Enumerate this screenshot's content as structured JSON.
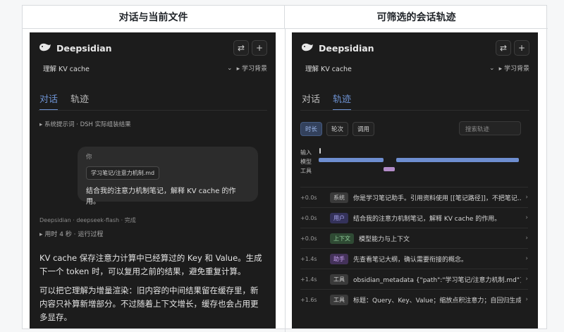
{
  "headers": {
    "left": "对话与当前文件",
    "right": "可筛选的会话轨迹"
  },
  "app": {
    "name": "Deepsidian",
    "conversation_title": "理解 KV cache",
    "context_label": "学习背景",
    "btn_sliders_icon": "sliders-icon",
    "btn_new_icon": "plus-icon"
  },
  "tabs": {
    "chat": "对话",
    "trace": "轨迹"
  },
  "left": {
    "system_line": "▸ 系统提示词 · DSH 实际组装结果",
    "user_bubble": {
      "who": "你",
      "attachment": "学习笔记/注意力机制.md",
      "message": "结合我的注意力机制笔记，解释 KV cache 的作用。"
    },
    "assistant_meta": "Deepsidian · deepseek-flash · 完成",
    "thinking": "▸ 用时 4 秒 · 运行过程",
    "answer_p1": "KV cache 保存注意力计算中已经算过的 Key 和 Value。生成下一个 token 时，可以复用之前的结果，避免重复计算。",
    "answer_p2": "可以把它理解为增量渲染：旧内容的中间结果留在缓存里，新内容只补算新增部分。不过随着上下文增长，缓存也会占用更多显存。"
  },
  "right": {
    "filters": [
      "时长",
      "轮次",
      "调用"
    ],
    "active_filter": "时长",
    "search_placeholder": "搜索轨迹",
    "lanes": [
      "输入",
      "模型",
      "工具"
    ],
    "rows": [
      {
        "time": "+0.0s",
        "kind": "系统",
        "text": "你是学习笔记助手。引用资料使用 [[笔记路径]]，不把笔记..."
      },
      {
        "time": "+0.0s",
        "kind": "用户",
        "text": "结合我的注意力机制笔记，解释 KV cache 的作用。"
      },
      {
        "time": "+0.0s",
        "kind": "上下文",
        "text": "模型能力与上下文"
      },
      {
        "time": "+1.4s",
        "kind": "助手",
        "text": "先查看笔记大纲，确认需要衔接的概念。"
      },
      {
        "time": "+1.4s",
        "kind": "工具",
        "text": "obsidian_metadata {\"path\":\"学习笔记/注意力机制.md\"}"
      },
      {
        "time": "+1.6s",
        "kind": "工具",
        "text": "标题：Query、Key、Value；缩放点积注意力；自回归生成..."
      }
    ]
  }
}
